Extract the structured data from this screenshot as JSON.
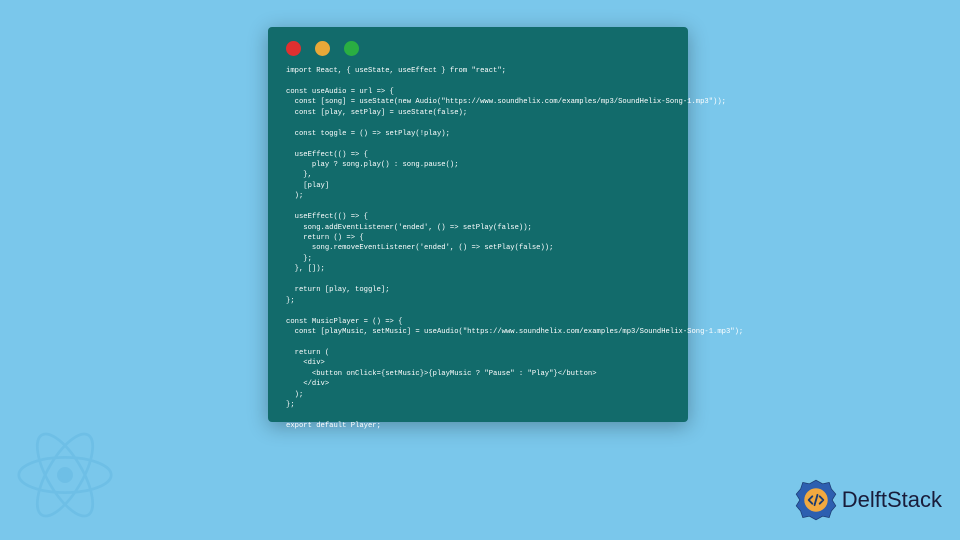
{
  "colors": {
    "page_bg": "#7ac7eb",
    "window_bg": "#126b6b",
    "code_text": "#ffffff",
    "dot_red": "#e03030",
    "dot_yellow": "#e8a838",
    "dot_green": "#2aae42",
    "logo_text": "#191c3a",
    "logo_accent": "#2d5fb0"
  },
  "code": {
    "lines": [
      "import React, { useState, useEffect } from \"react\";",
      "",
      "const useAudio = url => {",
      "  const [song] = useState(new Audio(\"https://www.soundhelix.com/examples/mp3/SoundHelix-Song-1.mp3\"));",
      "  const [play, setPlay] = useState(false);",
      "",
      "  const toggle = () => setPlay(!play);",
      "",
      "  useEffect(() => {",
      "      play ? song.play() : song.pause();",
      "    },",
      "    [play]",
      "  );",
      "",
      "  useEffect(() => {",
      "    song.addEventListener('ended', () => setPlay(false));",
      "    return () => {",
      "      song.removeEventListener('ended', () => setPlay(false));",
      "    };",
      "  }, []);",
      "",
      "  return [play, toggle];",
      "};",
      "",
      "const MusicPlayer = () => {",
      "  const [playMusic, setMusic] = useAudio(\"https://www.soundhelix.com/examples/mp3/SoundHelix-Song-1.mp3\");",
      "",
      "  return (",
      "    <div>",
      "      <button onClick={setMusic}>{playMusic ? \"Pause\" : \"Play\"}</button>",
      "    </div>",
      "  );",
      "};",
      "",
      "export default Player;"
    ]
  },
  "brand": {
    "name": "DelftStack"
  }
}
